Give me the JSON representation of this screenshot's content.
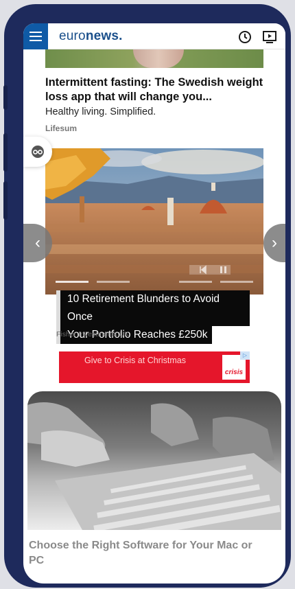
{
  "header": {
    "logo_main": "euro",
    "logo_bold": "news.",
    "menu_icon": "hamburger-icon",
    "history_icon": "clock-icon",
    "video_icon": "play-screen-icon",
    "brand_color": "#0f5aa6"
  },
  "article1": {
    "title": "Intermittent fasting: The Swedish weight loss app that will change you...",
    "subtitle": "Healthy living. Simplified.",
    "source": "Lifesum"
  },
  "share": {
    "icon": "reader-icon"
  },
  "carousel": {
    "caption_line1": "10 Retirement Blunders to Avoid Once",
    "caption_line2": "Your Portfolio Reaches £250k",
    "source": "Fisher Investments UK",
    "prev_icon": "chevron-left-icon",
    "next_icon": "chevron-right-icon"
  },
  "ad": {
    "text": "Give to Crisis at Christmas",
    "logo_text": "crisis",
    "badge": "▷",
    "color": "#e5162b"
  },
  "article3": {
    "title": "Choose the Right Software for Your Mac or PC"
  }
}
